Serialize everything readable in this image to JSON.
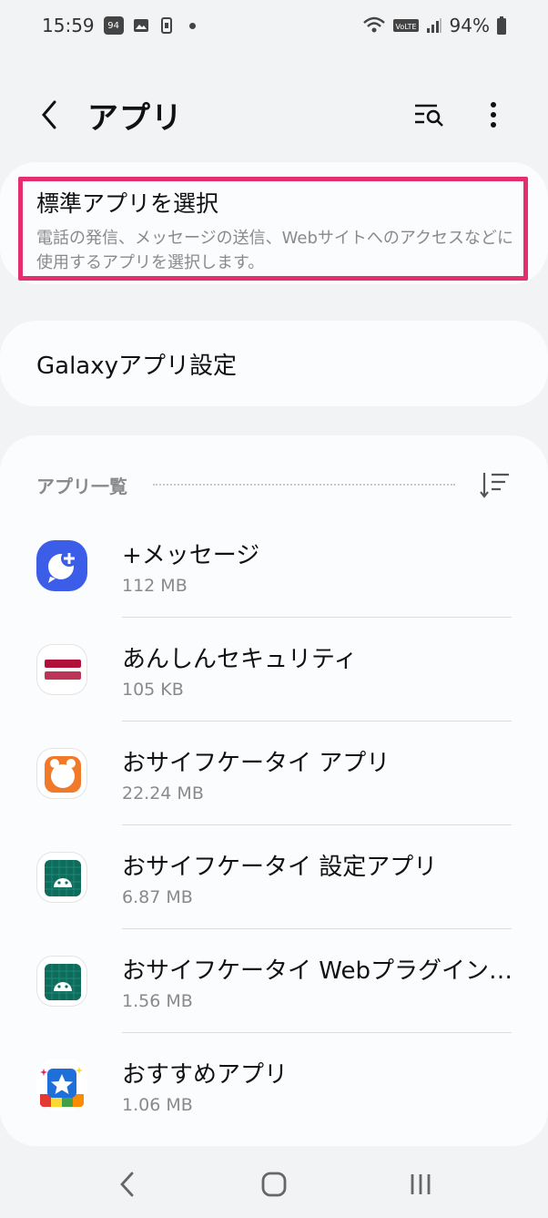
{
  "status": {
    "time": "15:59",
    "notif_badge": "94",
    "battery": "94%"
  },
  "appbar": {
    "title": "アプリ"
  },
  "default_apps": {
    "title": "標準アプリを選択",
    "description": "電話の発信、メッセージの送信、Webサイトへのアクセスなどに使用するアプリを選択します。"
  },
  "galaxy": {
    "label": "Galaxyアプリ設定"
  },
  "app_list": {
    "header": "アプリ一覧",
    "items": [
      {
        "name": "+メッセージ",
        "size": "112 MB",
        "icon": "plus-message-icon"
      },
      {
        "name": "あんしんセキュリティ",
        "size": "105 KB",
        "icon": "anshin-security-icon"
      },
      {
        "name": "おサイフケータイ アプリ",
        "size": "22.24 MB",
        "icon": "osaifu-keitai-icon"
      },
      {
        "name": "おサイフケータイ 設定アプリ",
        "size": "6.87 MB",
        "icon": "android-icon"
      },
      {
        "name": "おサイフケータイ Webプラグイン…",
        "size": "1.56 MB",
        "icon": "android-icon"
      },
      {
        "name": "おすすめアプリ",
        "size": "1.06 MB",
        "icon": "recommended-apps-icon"
      }
    ]
  },
  "colors": {
    "highlight": "#e52e6f",
    "background": "#f2f3f5",
    "card": "#fafcfd"
  }
}
